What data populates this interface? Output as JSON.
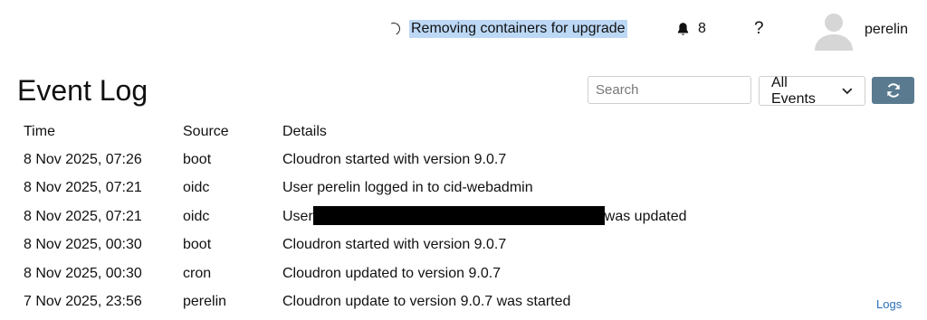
{
  "task_indicator": {
    "text": "Removing containers for upgrade"
  },
  "notifications": {
    "count": "8",
    "icon": "bell-icon"
  },
  "help": {
    "label": "?"
  },
  "user": {
    "name": "perelin",
    "avatar_icon": "user-avatar-icon"
  },
  "page": {
    "title": "Event Log"
  },
  "search": {
    "placeholder": "Search",
    "value": ""
  },
  "filter": {
    "selected": "All Events"
  },
  "table": {
    "headers": {
      "time": "Time",
      "source": "Source",
      "details": "Details"
    },
    "rows": [
      {
        "time": "8 Nov 2025, 07:26",
        "source": "boot",
        "details": "Cloudron started with version 9.0.7"
      },
      {
        "time": "8 Nov 2025, 07:21",
        "source": "oidc",
        "details": "User perelin logged in to cid-webadmin"
      },
      {
        "time": "8 Nov 2025, 07:21",
        "source": "oidc",
        "details_prefix": "User",
        "details_suffix": "was updated"
      },
      {
        "time": "8 Nov 2025, 00:30",
        "source": "boot",
        "details": "Cloudron started with version 9.0.7"
      },
      {
        "time": "8 Nov 2025, 00:30",
        "source": "cron",
        "details": "Cloudron updated to version 9.0.7"
      },
      {
        "time": "7 Nov 2025, 23:56",
        "source": "perelin",
        "details": "Cloudron update to version 9.0.7 was started"
      }
    ]
  },
  "logs_link": {
    "label": "Logs"
  },
  "colors": {
    "refresh_button": "#5a7b8f",
    "selection_highlight": "#bcd8f5",
    "link": "#2a6fb8"
  }
}
